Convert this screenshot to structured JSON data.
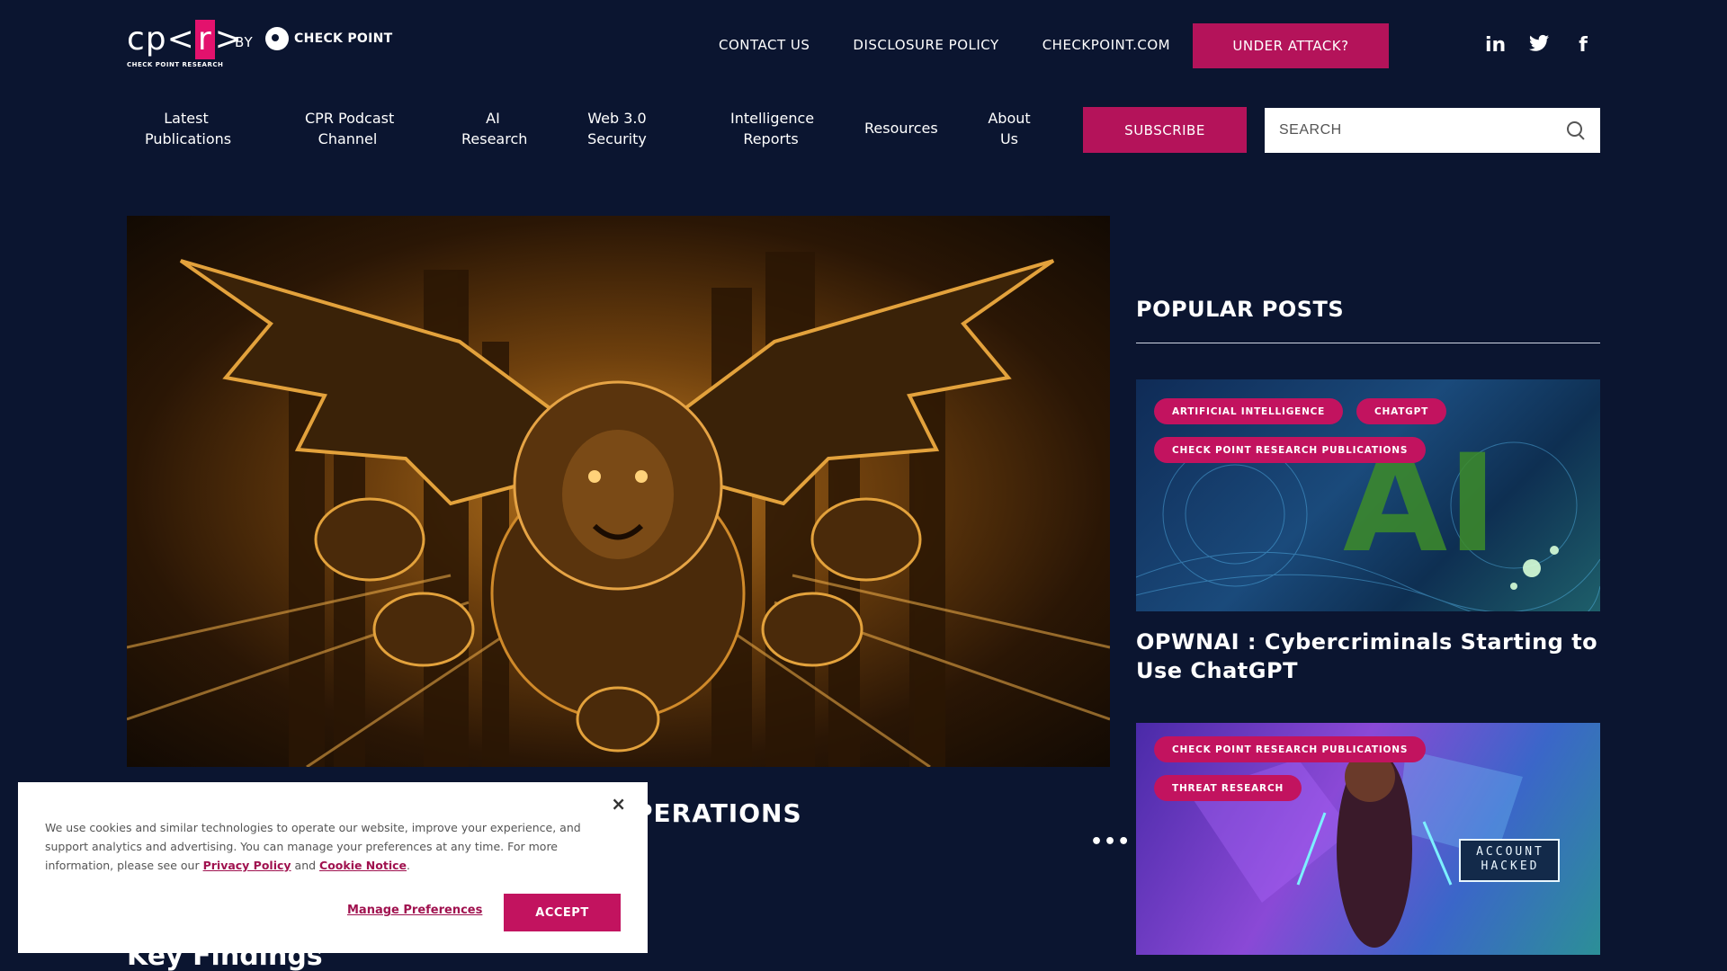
{
  "brand": {
    "logo_prefix": "cp<",
    "logo_r": "r",
    "logo_suffix": ">",
    "logo_sub": "CHECK POINT RESEARCH",
    "by": "BY",
    "partner": "CHECK POINT"
  },
  "top_nav": {
    "links": [
      "CONTACT US",
      "DISCLOSURE POLICY",
      "CHECKPOINT.COM"
    ],
    "under_attack": "UNDER ATTACK?",
    "social": [
      "linkedin-icon",
      "twitter-icon",
      "facebook-icon"
    ]
  },
  "main_nav": {
    "items": [
      {
        "line1": "Latest",
        "line2": "Publications"
      },
      {
        "line1": "CPR Podcast",
        "line2": "Channel"
      },
      {
        "line1": "AI",
        "line2": "Research"
      },
      {
        "line1": "Web 3.0",
        "line2": "Security"
      },
      {
        "line1": "Intelligence",
        "line2": "Reports"
      },
      {
        "line1": "Resources",
        "line2": ""
      },
      {
        "line1": "About",
        "line2": "Us"
      }
    ],
    "subscribe": "SUBSCRIBE",
    "search_placeholder": "SEARCH"
  },
  "hero": {
    "title_visible": "PERATIONS",
    "more": "•••",
    "section_heading": "Key Findings"
  },
  "sidebar": {
    "title": "POPULAR POSTS",
    "posts": [
      {
        "tags": [
          "ARTIFICIAL INTELLIGENCE",
          "CHATGPT",
          "CHECK POINT RESEARCH PUBLICATIONS"
        ],
        "title": "OPWNAI : Cybercriminals Starting to Use ChatGPT",
        "image_overlay": "AI"
      },
      {
        "tags": [
          "CHECK POINT RESEARCH PUBLICATIONS",
          "THREAT RESEARCH"
        ],
        "image_overlay": "ACCOUNT HACKED"
      }
    ]
  },
  "cookie": {
    "text_before": "We use cookies and similar technologies to operate our website, improve your experience, and support analytics and advertising. You can manage your preferences at any time. For more information, please see our ",
    "privacy": "Privacy Policy",
    "and": " and ",
    "notice": "Cookie Notice",
    "period": ".",
    "manage": "Manage Preferences",
    "accept": "ACCEPT",
    "close": "×"
  },
  "colors": {
    "background": "#0b1530",
    "accent": "#b4135a",
    "tag": "#c2135f"
  }
}
